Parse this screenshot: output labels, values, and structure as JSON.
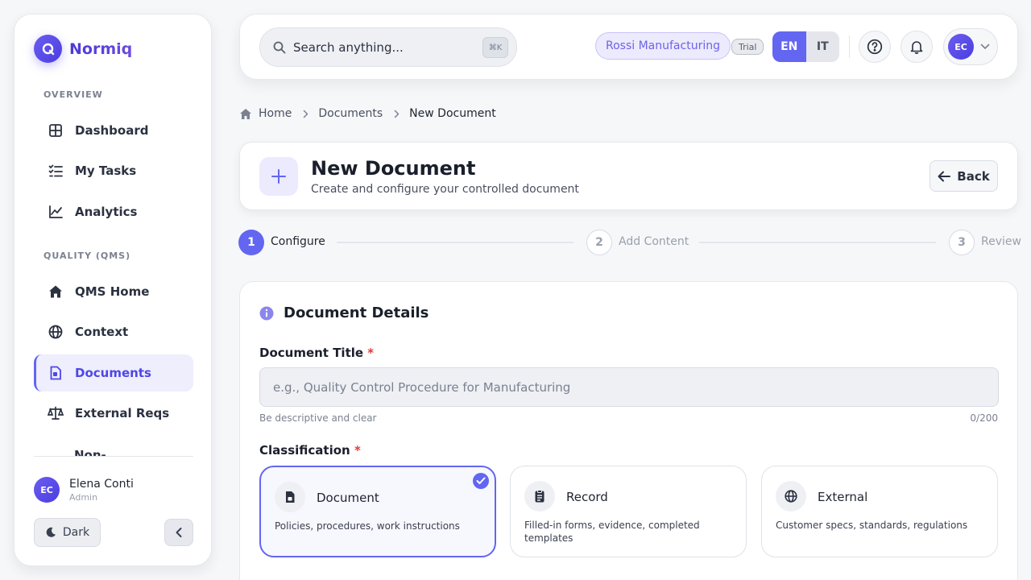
{
  "app": {
    "name": "Normiq"
  },
  "sidebar": {
    "sections": [
      {
        "label": "OVERVIEW"
      },
      {
        "label": "QUALITY (QMS)"
      }
    ],
    "items": [
      {
        "label": "Dashboard",
        "icon": "grid-icon"
      },
      {
        "label": "My Tasks",
        "icon": "checklist-icon"
      },
      {
        "label": "Analytics",
        "icon": "chart-line-icon"
      },
      {
        "label": "QMS Home",
        "icon": "home-icon"
      },
      {
        "label": "Context",
        "icon": "globe-icon"
      },
      {
        "label": "Documents",
        "icon": "document-icon",
        "active": true
      },
      {
        "label": "External Reqs",
        "icon": "scale-icon"
      },
      {
        "label": "Non-",
        "icon": ""
      }
    ],
    "user": {
      "initials": "EC",
      "name": "Elena Conti",
      "role": "Admin"
    },
    "theme_button": "Dark"
  },
  "topbar": {
    "search_placeholder": "Search anything...",
    "search_shortcut": "⌘K",
    "org_name": "Rossi Manufacturing",
    "plan_badge": "Trial",
    "languages": [
      "EN",
      "IT"
    ],
    "active_language": "EN",
    "avatar_initials": "EC"
  },
  "breadcrumb": [
    "Home",
    "Documents",
    "New Document"
  ],
  "header": {
    "title": "New Document",
    "subtitle": "Create and configure your controlled document",
    "back_label": "Back"
  },
  "stepper": [
    {
      "num": "1",
      "label": "Configure",
      "active": true
    },
    {
      "num": "2",
      "label": "Add Content",
      "active": false
    },
    {
      "num": "3",
      "label": "Review",
      "active": false
    }
  ],
  "details": {
    "title": "Document Details",
    "title_field": {
      "label": "Document Title",
      "required_mark": "*",
      "placeholder": "e.g., Quality Control Procedure for Manufacturing",
      "hint": "Be descriptive and clear",
      "counter": "0/200"
    },
    "classification": {
      "label": "Classification",
      "required_mark": "*",
      "options": [
        {
          "title": "Document",
          "desc": "Policies, procedures, work instructions",
          "selected": true
        },
        {
          "title": "Record",
          "desc": "Filled-in forms, evidence, completed templates",
          "selected": false
        },
        {
          "title": "External",
          "desc": "Customer specs, standards, regulations",
          "selected": false
        }
      ]
    }
  },
  "colors": {
    "accent": "#6366f1",
    "required": "#e53935"
  }
}
